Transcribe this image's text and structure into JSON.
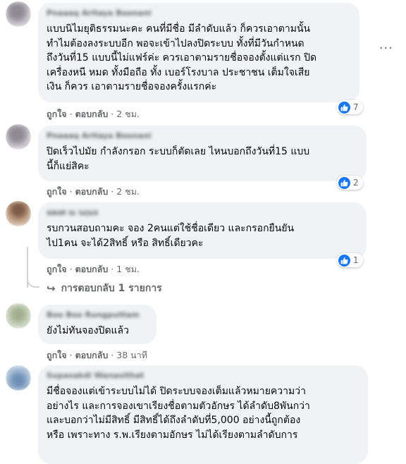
{
  "comments": [
    {
      "author": "Pnaaaq Aritaya Boonani",
      "text": "แบบนิไมยุติธรรมนะคะ คนที่มีชื่อ มีลำดับแล้ว ก็ควรเอาตามนั้น\nทำไมต้องลงระบบอีก พอจะเข้าไปลงปิดระบบ ทั้งที่มีวันกำหนด\nถึงวันที่15 แบบนี้ไม่แฟร์ค่ะ ควรเอาตามรายชื่อจองตั้งแต่แรก ปิด\nเครื่องหนี หมด ทั้งมือถือ ทั้ง เบอร์โรงบาล ประชาชน เต็มใจเสีย\nเงิน ก็ควร เอาตามรายชื่อจองครั้งแรกค่ะ",
      "like": "ถูกใจ",
      "reply": "ตอบกลับ",
      "time": "2 ชม.",
      "reactions": "7"
    },
    {
      "author": "Pnaaaq Aritaya Boonani",
      "text": "ปิดเร็วไปมัย กำลังกรอก ระบบก็ตัดเลย ไหนบอกถึงวันที่15 แบบ\nนี้ก็แย่สิคะ",
      "like": "ถูกใจ",
      "reply": "ตอบกลับ",
      "time": "2 ชม.",
      "reactions": "2"
    },
    {
      "author": "ฉพงศ ณ นฤมล",
      "text": "รบกวนสอบถามคะ จอง 2คนแต่ใช้ชื่อเดียว และกรอกยืนยัน\nไป1คน จะได้2สิทธิ์ หรือ สิทธิ์เดียวคะ",
      "like": "ถูกใจ",
      "reply": "ตอบกลับ",
      "time": "1 ชม.",
      "reactions": "1"
    },
    {
      "author": "Boo Boo Rungputtam",
      "text": "ยังไม่ทันจองปิดแล้ว",
      "like": "ถูกใจ",
      "reply": "ตอบกลับ",
      "time": "38 นาที"
    },
    {
      "author": "Supasakdi Wanasithat",
      "text": "มีชื่อจองแต่เข้าระบบไม่ได้ ปิดระบบจองเต็มแล้วหมายความว่า\nอย่างไร และการจองเขาเรียงชื่อตามตัวอักษร ได้ลำดับ8พันกว่า\nและบอกว่าไม่มีสิทธิ์ มีสิทธิ์ได้ถึงลำดับที่5,000 อย่างนี้ถูกต้อง\nหรือ เพราะทาง ร.พ.เรียงตามอักษร ไม่ได้เรียงตามลำดับการ"
    }
  ],
  "replies_link": "การตอบกลับ 1 รายการ",
  "more_options": "···"
}
